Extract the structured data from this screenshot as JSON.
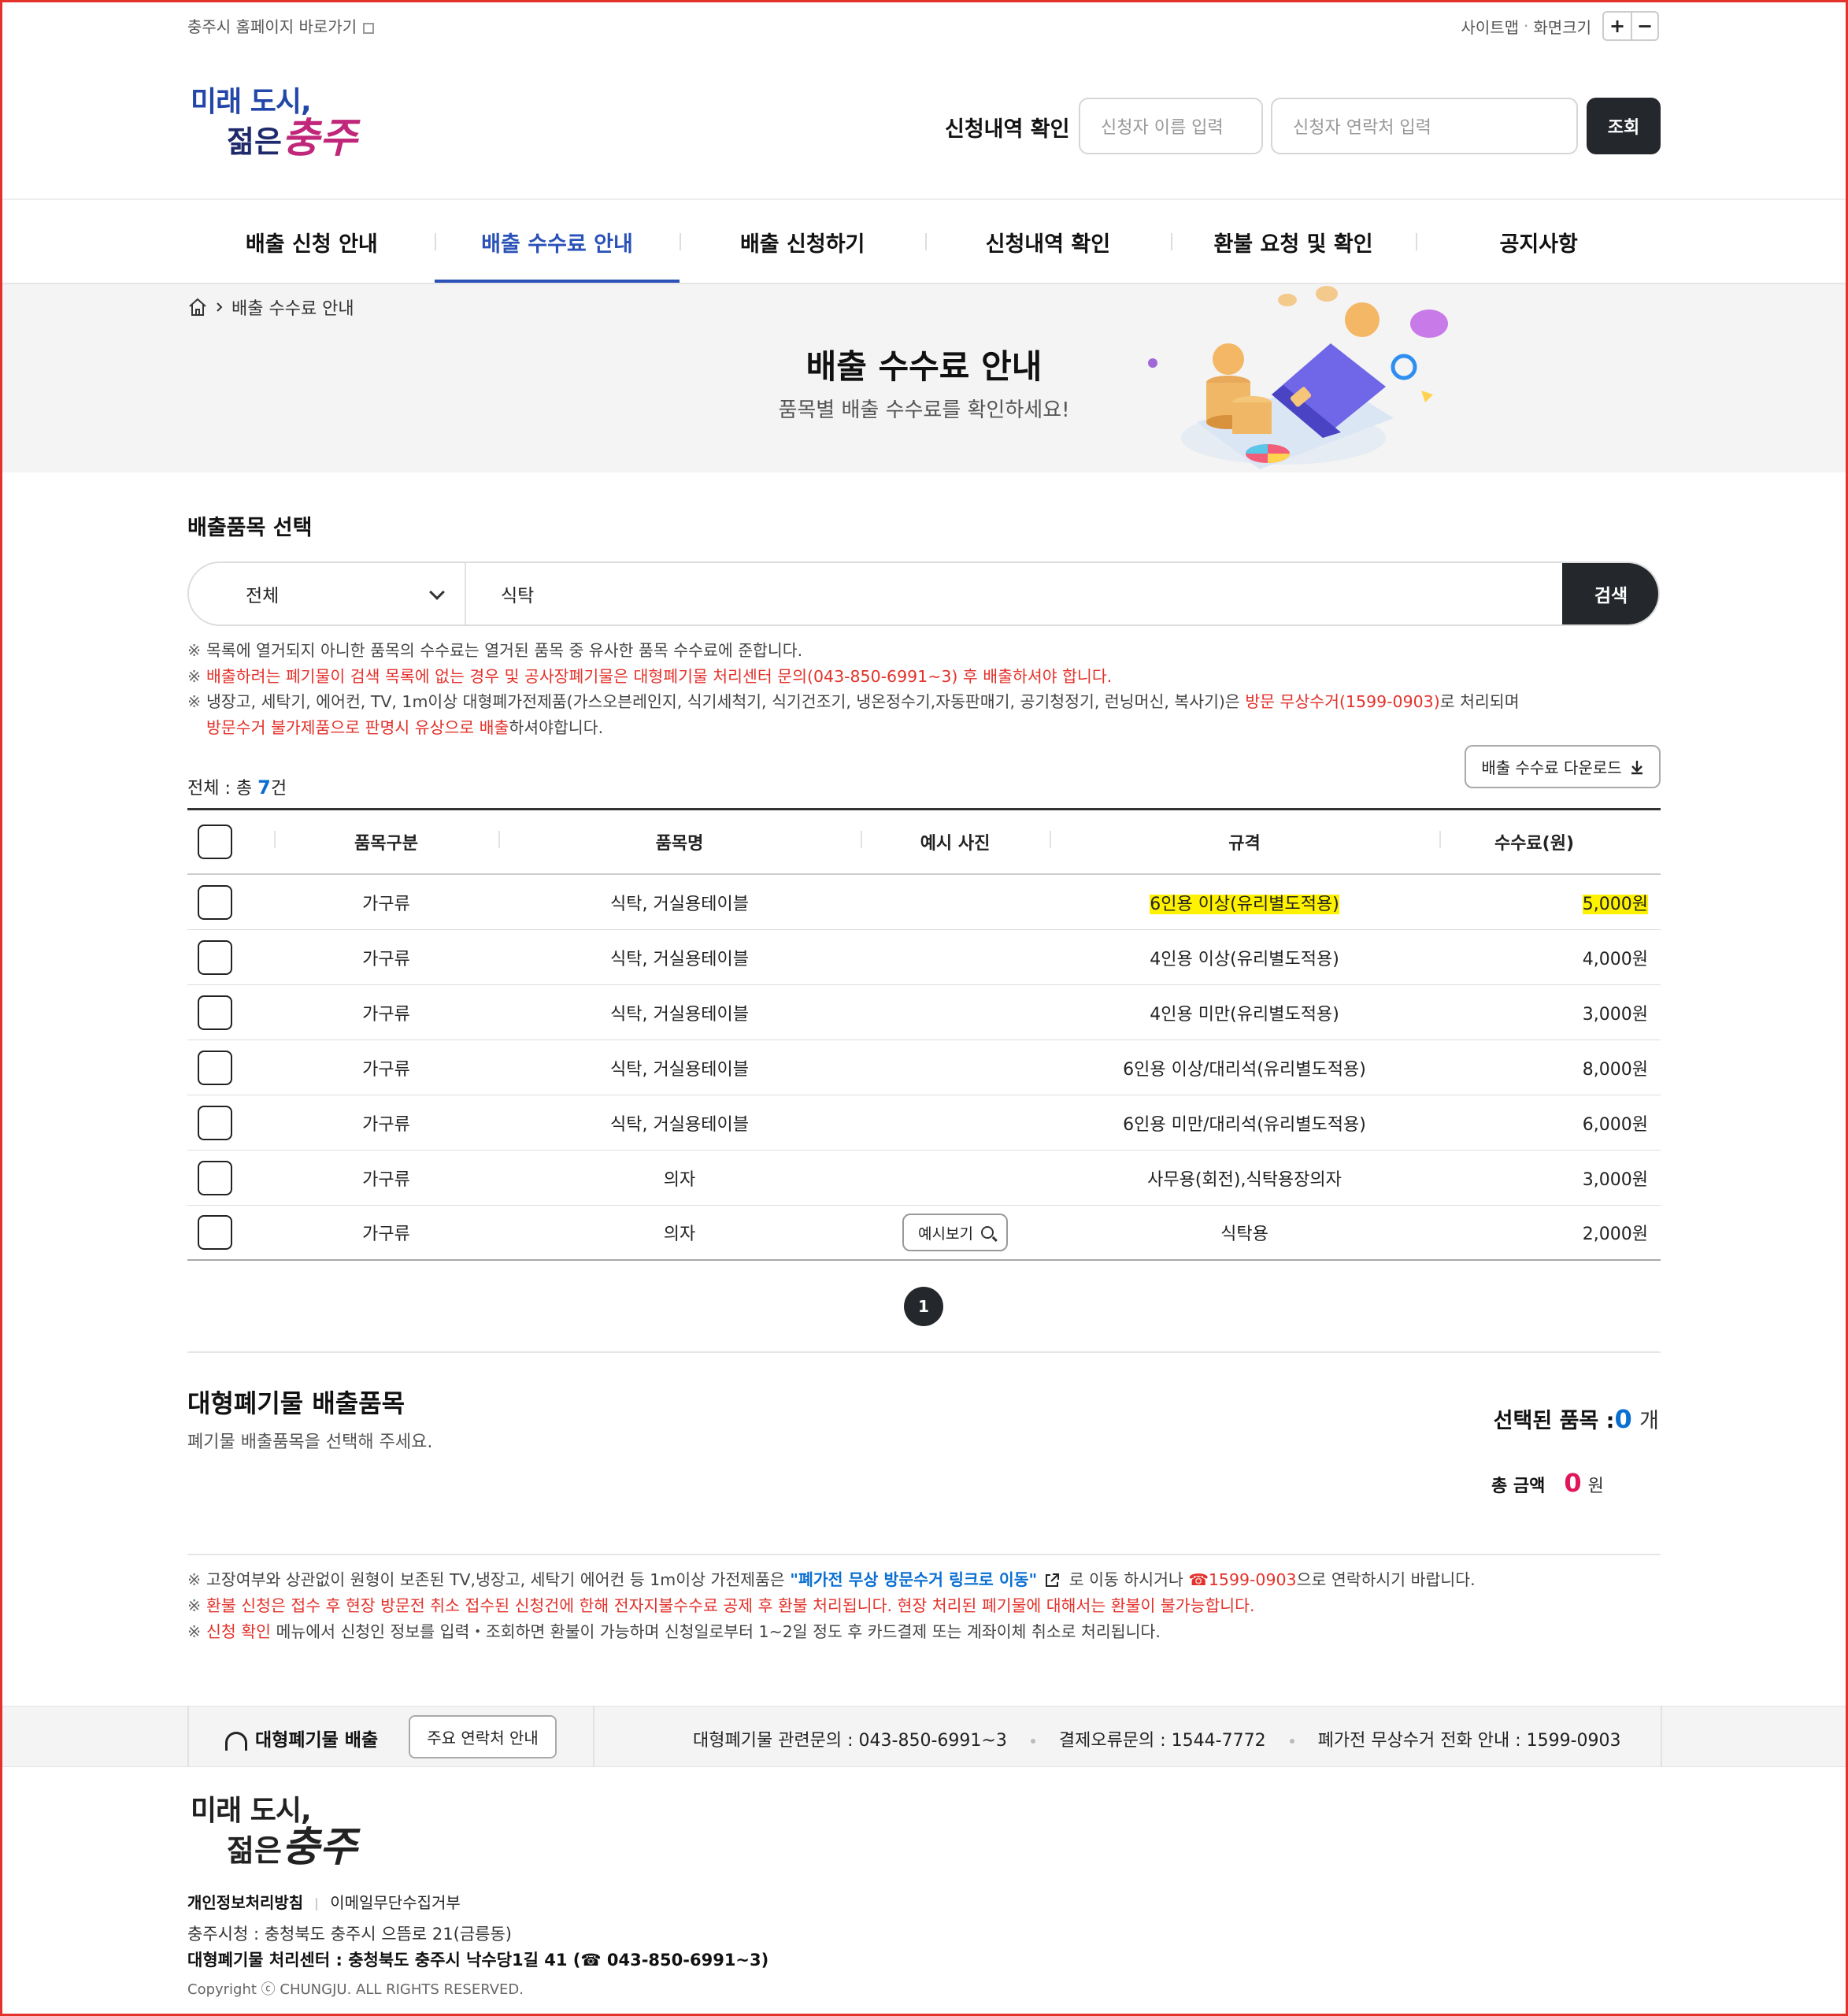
{
  "top_util": {
    "homepage_link": "충주시 홈페이지 바로가기",
    "sitemap": "사이트맵",
    "font_size": "화면크기",
    "zoom_in": "+",
    "zoom_out": "−"
  },
  "logo": {
    "line1": "미래 도시,",
    "line2a": "젊은",
    "line2b": "충주"
  },
  "lookup": {
    "title": "신청내역 확인",
    "name_placeholder": "신청자 이름 입력",
    "phone_placeholder": "신청자 연락처 입력",
    "button": "조회"
  },
  "nav": {
    "items": [
      "배출 신청 안내",
      "배출 수수료 안내",
      "배출 신청하기",
      "신청내역 확인",
      "환불 요청 및 확인",
      "공지사항"
    ],
    "active_index": 1
  },
  "breadcrumb": {
    "current": "배출 수수료 안내"
  },
  "banner": {
    "title": "배출 수수료 안내",
    "subtitle": "품목별 배출 수수료를 확인하세요!"
  },
  "select_section": {
    "title": "배출품목 선택",
    "category_value": "전체",
    "query_value": "식탁",
    "search_button": "검색"
  },
  "notes": {
    "n1": "목록에 열거되지 아니한 품목의 수수료는 열거된 품목 중 유사한 품목 수수료에 준합니다.",
    "n2": "배출하려는 폐기물이 검색 목록에 없는 경우 및 공사장폐기물은 대형폐기물 처리센터 문의(043-850-6991~3) 후 배출하셔야 합니다.",
    "n3a": "냉장고, 세탁기, 에어컨, TV, 1m이상 대형폐가전제품(가스오븐레인지, 식기세척기, 식기건조기, 냉온정수기,자동판매기, 공기청정기, 런닝머신, 복사기)은 ",
    "n3b": "방문 무상수거(1599-0903)",
    "n3c": "로 처리되며",
    "n3d": "방문수거 불가제품으로 판명시 유상으로 배출",
    "n3e": "하셔야합니다."
  },
  "total": {
    "prefix": "전체 : 총",
    "count": "7",
    "suffix": "건"
  },
  "download_button": "배출 수수료 다운로드",
  "table": {
    "headers": [
      "품목구분",
      "품목명",
      "예시 사진",
      "규격",
      "수수료(원)"
    ],
    "rows": [
      {
        "category": "가구류",
        "name": "식탁, 거실용테이블",
        "photo": "",
        "spec": "6인용 이상(유리별도적용)",
        "fee": "5,000원"
      },
      {
        "category": "가구류",
        "name": "식탁, 거실용테이블",
        "photo": "",
        "spec": "4인용 이상(유리별도적용)",
        "fee": "4,000원"
      },
      {
        "category": "가구류",
        "name": "식탁, 거실용테이블",
        "photo": "",
        "spec": "4인용 미만(유리별도적용)",
        "fee": "3,000원"
      },
      {
        "category": "가구류",
        "name": "식탁, 거실용테이블",
        "photo": "",
        "spec": "6인용 이상/대리석(유리별도적용)",
        "fee": "8,000원"
      },
      {
        "category": "가구류",
        "name": "식탁, 거실용테이블",
        "photo": "",
        "spec": "6인용 미만/대리석(유리별도적용)",
        "fee": "6,000원"
      },
      {
        "category": "가구류",
        "name": "의자",
        "photo": "",
        "spec": "사무용(회전),식탁용장의자",
        "fee": "3,000원"
      },
      {
        "category": "가구류",
        "name": "의자",
        "photo": "예시보기",
        "spec": "식탁용",
        "fee": "2,000원"
      }
    ]
  },
  "pagination": {
    "current": "1"
  },
  "discharge": {
    "title": "대형폐기물 배출품목",
    "subtitle": "폐기물 배출품목을 선택해 주세요.",
    "selected_label": "선택된 품목 :",
    "selected_count": "0",
    "selected_unit": "개",
    "amount_label": "총 금액",
    "amount_value": "0",
    "amount_unit": "원"
  },
  "notes2": {
    "a1": "고장여부와 상관없이 원형이 보존된 TV,냉장고, 세탁기 에어컨 등 1m이상 가전제품은 ",
    "a2": "\"폐가전 무상 방문수거 링크로 이동\"",
    "a3": " 로 이동 하시거나 ",
    "a4": "☎1599-0903",
    "a5": "으로 연락하시기 바랍니다.",
    "b": "환불 신청은 접수 후 현장 방문전 취소 접수된 신청건에 한해 전자지불수수료 공제 후 환불 처리됩니다. 현장 처리된 폐기물에 대해서는 환불이 불가능합니다.",
    "c1": "신청 확인",
    "c2": " 메뉴에서 신청인 정보를 입력・조회하면 환불이 가능하며 신청일로부터 1~2일 정도 후 카드결제 또는 계좌이체 취소로 처리됩니다."
  },
  "footer_bar": {
    "title": "대형폐기물 배출",
    "contact_button": "주요 연락처 안내",
    "contact1": "대형폐기물 관련문의 : 043-850-6991~3",
    "contact2": "결제오류문의 : 1544-7772",
    "contact3": "폐가전 무상수거 전화 안내 : 1599-0903"
  },
  "footer": {
    "privacy": "개인정보처리방침",
    "email_refuse": "이메일무단수집거부",
    "address1": "충주시청 : 충청북도 충주시 으뜸로 21(금릉동)",
    "address2": "대형폐기물 처리센터 : 충청북도 충주시 낙수당1길 41 (☎ 043-850-6991~3)",
    "copyright": "Copyright ⓒ CHUNGJU. ALL RIGHTS RESERVED."
  },
  "colors": {
    "brand_blue": "#2a51b8",
    "accent_red": "#e3322b",
    "count_blue": "#0a6fd1",
    "amount_pink": "#e0175a",
    "highlight": "#fff200",
    "dark": "#24272c"
  }
}
